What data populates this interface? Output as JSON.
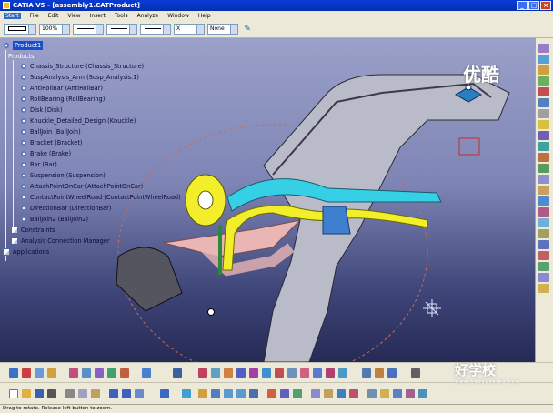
{
  "window": {
    "title": "CATIA V5 - [assembly1.CATProduct]"
  },
  "menu": [
    "Start",
    "File",
    "Edit",
    "View",
    "Insert",
    "Tools",
    "Analyze",
    "Window",
    "Help"
  ],
  "properties_bar": {
    "zoom": "100%",
    "color": "None",
    "layer": "X",
    "close_btn": "×"
  },
  "tree": {
    "root": "Product1",
    "products_label": "Products",
    "items": [
      "Chassis_Structure (Chassis_Structure)",
      "SuspAnalysis_Arm (Susp_Analysis.1)",
      "AntiRollBar (AntiRollBar)",
      "RollBearing (RollBearing)",
      "Disk (Disk)",
      "Knuckle_Detailed_Design (Knuckle)",
      "BallJoin (BallJoin)",
      "Bracket (Bracket)",
      "Brake (Brake)",
      "Bar (Bar)",
      "Suspension (Suspension)",
      "AttachPointOnCar (AttachPointOnCar)",
      "ContactPointWheelRoad (ContactPointWheelRoad)",
      "DirectionBar (DirectionBar)",
      "BallJoin2 (BallJoin2)"
    ],
    "constraints": "Constraints",
    "analysis": "Analysis Connection Manager",
    "applications": "Applications"
  },
  "status": {
    "text": "Drag to rotate. Release left button to zoom."
  },
  "watermarks": {
    "top_right": "优酷",
    "bottom_right": "好学校",
    "bottom_right_small": "www.haoxuexiao.com"
  },
  "colors": {
    "title_bar": "#0a3bd6",
    "viewport_top": "#9aa0c8",
    "viewport_bottom": "#262a55",
    "tree_highlight": "#1a4ecb",
    "yellow_part": "#f2ee2a",
    "cyan_part": "#36d0e6",
    "pink_part": "#e9b5b5"
  },
  "icons": [
    "catia-app-icon",
    "minimize-icon",
    "maximize-icon",
    "close-icon",
    "compass-icon",
    "axis-icon",
    "part-gear-icon"
  ]
}
